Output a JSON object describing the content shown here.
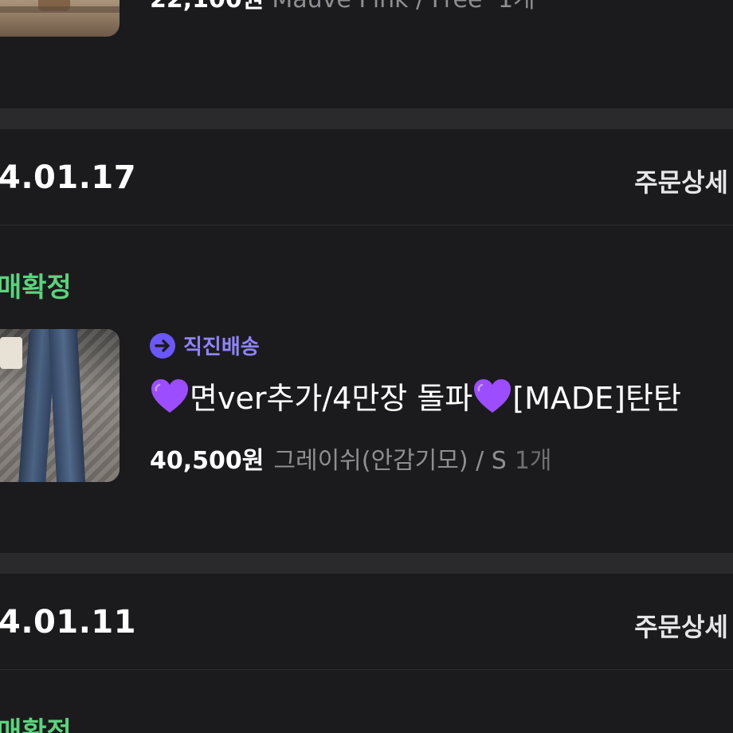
{
  "top_order": {
    "price": "22,100원",
    "option": "Mauve Pink / Free",
    "qty": "1개"
  },
  "orders": [
    {
      "date": "4.01.17",
      "detail_label": "주문상세",
      "status": "매확정",
      "delivery_label": "직진배송",
      "product_name": "면ver추가/4만장 돌파",
      "product_name_suffix": "[MADE]탄탄",
      "price": "40,500원",
      "option": "그레이쉬(안감기모) / S",
      "qty": "1개"
    },
    {
      "date": "4.01.11",
      "detail_label": "주문상세",
      "status": "매확정"
    }
  ],
  "colors": {
    "background": "#1b1b1d",
    "divider": "#2a2a2d",
    "status": "#5bd37d",
    "delivery_accent": "#8f84ff",
    "heart": "#9b4dff"
  },
  "icons": {
    "delivery": "arrow-right-circle-icon",
    "heart": "purple-heart-emoji"
  }
}
